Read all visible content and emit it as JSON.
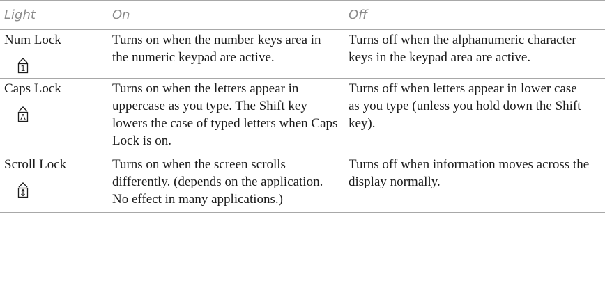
{
  "table": {
    "headers": {
      "light": "Light",
      "on": "On",
      "off": "Off"
    },
    "rows": [
      {
        "light": "Num Lock",
        "icon": "num-lock-indicator-icon",
        "icon_glyph": "1",
        "on": "Turns on when the number keys area in the numeric keypad are active.",
        "off": "Turns off when the alphanumeric character keys in the keypad area are active."
      },
      {
        "light": "Caps Lock",
        "icon": "caps-lock-indicator-icon",
        "icon_glyph": "A",
        "on": "Turns on when the letters appear in uppercase as you type. The Shift key lowers the case of typed letters when Caps Lock is on.",
        "off": "Turns off when letters appear in lower case as you type (unless you hold down the Shift key)."
      },
      {
        "light": "Scroll Lock",
        "icon": "scroll-lock-indicator-icon",
        "icon_glyph": "↕",
        "on": "Turns on when the screen scrolls differently. (depends on the application. No effect in many applications.)",
        "off": "Turns off when information moves across the display normally."
      }
    ]
  },
  "colors": {
    "header_text": "#8a8a8a",
    "rule": "#a8a8a8",
    "body_text": "#1c1c1c"
  }
}
